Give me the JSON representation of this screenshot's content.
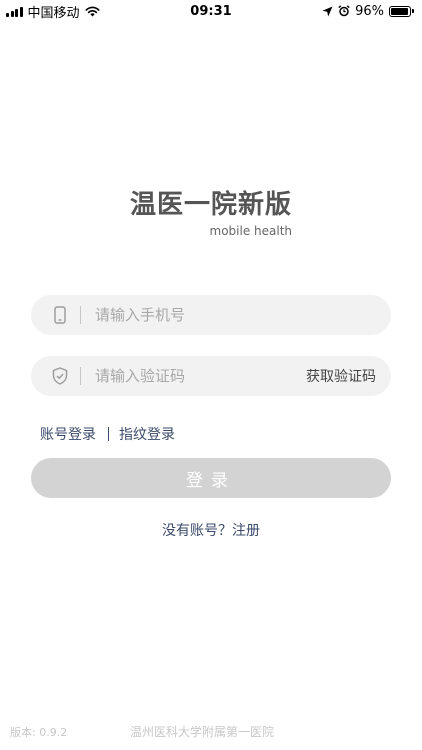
{
  "status_bar": {
    "carrier": "中国移动",
    "time": "09:31",
    "battery": "96%",
    "battery_level": 0.96
  },
  "header": {
    "title": "温医一院新版",
    "subtitle": "mobile health"
  },
  "form": {
    "phone_placeholder": "请输入手机号",
    "code_placeholder": "请输入验证码",
    "get_code_label": "获取验证码"
  },
  "login_options": {
    "account_login": "账号登录",
    "fingerprint_login": "指纹登录"
  },
  "login_button": {
    "label": "登录"
  },
  "register_link": "没有账号？注册",
  "footer": {
    "version": "版本: 0.9.2",
    "organization": "温州医科大学附属第一医院"
  },
  "colors": {
    "accent_text": "#3b4a6b",
    "button_disabled": "#d3d3d3",
    "field_bg": "#f2f2f2"
  },
  "icons": [
    "signal-icon",
    "wifi-icon",
    "location-arrow-icon",
    "alarm-icon",
    "battery-icon",
    "phone-icon",
    "shield-check-icon"
  ]
}
